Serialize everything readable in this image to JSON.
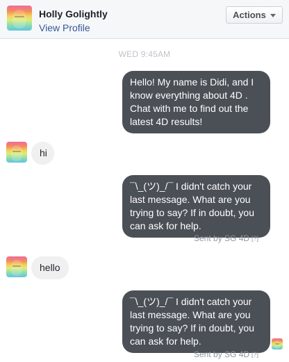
{
  "header": {
    "name": "Holly Golightly",
    "view_profile": "View Profile",
    "actions_label": "Actions",
    "avatar_icon": "profile-photo-icon",
    "caret_icon": "chevron-down-icon"
  },
  "conversation": {
    "timestamp": "WED 9:45AM",
    "messages": [
      {
        "direction": "outgoing",
        "text": "Hello! My name is Didi, and I\nknow everything about 4D .\nChat with me to find out the\nlatest 4D results!"
      },
      {
        "direction": "incoming",
        "text": "hi"
      },
      {
        "direction": "outgoing",
        "text": "¯\\_(ツ)_/¯ I didn't catch your\nlast message. What are you\ntrying to say? If in doubt, you\ncan ask for help."
      },
      {
        "direction": "incoming",
        "text": "hello"
      },
      {
        "direction": "outgoing",
        "text": "¯\\_(ツ)_/¯ I didn't catch your\nlast message. What are you\ntrying to say? If in doubt, you\ncan ask for help."
      }
    ],
    "sent_by": "Sent by SG 4D",
    "help_marker": "[?]"
  },
  "colors": {
    "outgoing_bubble": "#4b4f56",
    "incoming_bubble": "#f1f0f0",
    "link": "#365899",
    "header_bg": "#f6f7f9"
  }
}
